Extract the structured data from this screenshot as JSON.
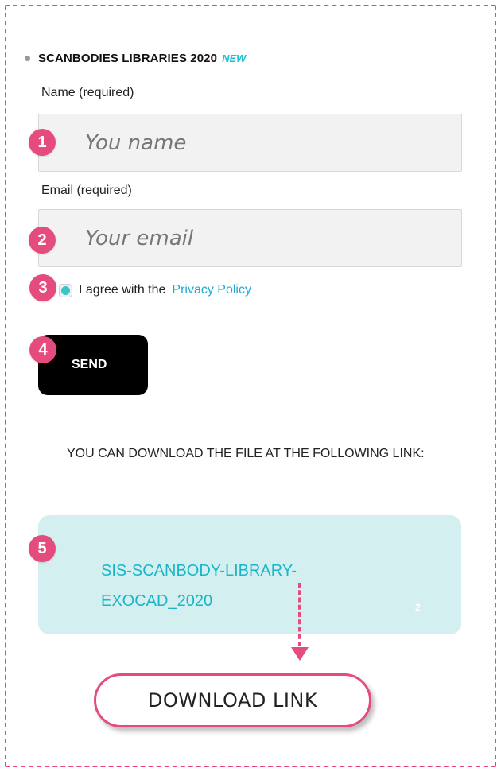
{
  "form": {
    "heading": {
      "title": "SCANBODIES LIBRARIES 2020",
      "badge": "NEW"
    },
    "name_label": "Name (required)",
    "name_placeholder": "You name",
    "email_label": "Email (required)",
    "email_placeholder": "Your email",
    "agree_text": "I agree with the",
    "privacy_link": "Privacy Policy",
    "send_label": "SEND"
  },
  "download": {
    "message": "YOU CAN DOWNLOAD THE FILE AT THE FOLLOWING LINK:",
    "file_link": "SIS-SCANBODY-LIBRARY-EXOCAD_2020",
    "box_counter": "2",
    "download_button": "DOWNLOAD LINK"
  },
  "markers": [
    "1",
    "2",
    "3",
    "4",
    "5"
  ],
  "colors": {
    "accent_pink": "#e64b7e",
    "link_teal": "#19b6c9",
    "box_bg": "#d4efef",
    "button_bg": "#000000"
  },
  "icons": {
    "bullet": "bullet-icon",
    "checkbox": "checkbox-checked-icon",
    "arrow": "arrow-down-icon"
  }
}
